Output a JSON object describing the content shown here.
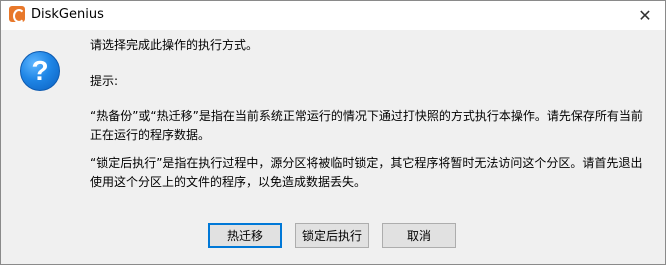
{
  "window": {
    "title": "DiskGenius"
  },
  "dialog": {
    "line1": "请选择完成此操作的执行方式。",
    "line2": "提示:",
    "para1": "“热备份”或“热迁移”是指在当前系统正常运行的情况下通过打快照的方式执行本操作。请先保存所有当前正在运行的程序数据。",
    "para2": "“锁定后执行”是指在执行过程中，源分区将被临时锁定，其它程序将暂时无法访问这个分区。请首先退出使用这个分区上的文件的程序，以免造成数据丢失。"
  },
  "buttons": {
    "hot_migrate": "热迁移",
    "lock_execute": "锁定后执行",
    "cancel": "取消"
  },
  "icons": {
    "app": "diskgenius-logo-icon",
    "close": "close-icon",
    "question": "question-icon"
  }
}
